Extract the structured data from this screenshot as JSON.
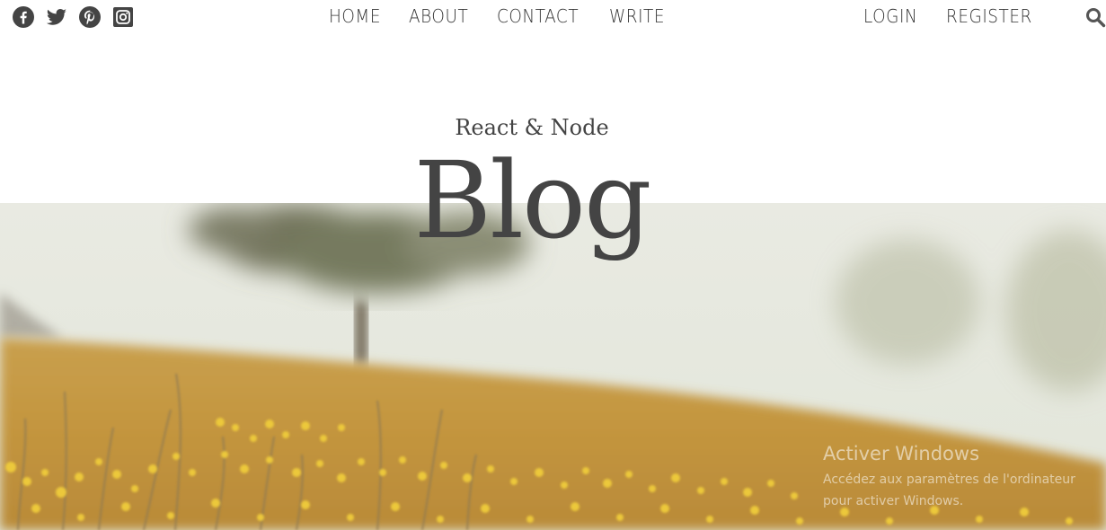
{
  "social": {
    "icons": [
      "facebook-icon",
      "twitter-icon",
      "pinterest-icon",
      "instagram-icon"
    ]
  },
  "nav": {
    "center": [
      "HOME",
      "ABOUT",
      "CONTACT",
      "WRITE"
    ],
    "right": [
      "LOGIN",
      "REGISTER"
    ]
  },
  "header": {
    "title_sm": "React & Node",
    "title_lg": "Blog"
  },
  "watermark": {
    "title": "Activer Windows",
    "line1": "Accédez aux paramètres de l'ordinateur",
    "line2": "pour activer Windows."
  },
  "colors": {
    "text": "#444444",
    "nav_text": "#333333",
    "sky": "#e6e8de",
    "field": "#c99a3f",
    "flowers": "#e8c23a"
  }
}
